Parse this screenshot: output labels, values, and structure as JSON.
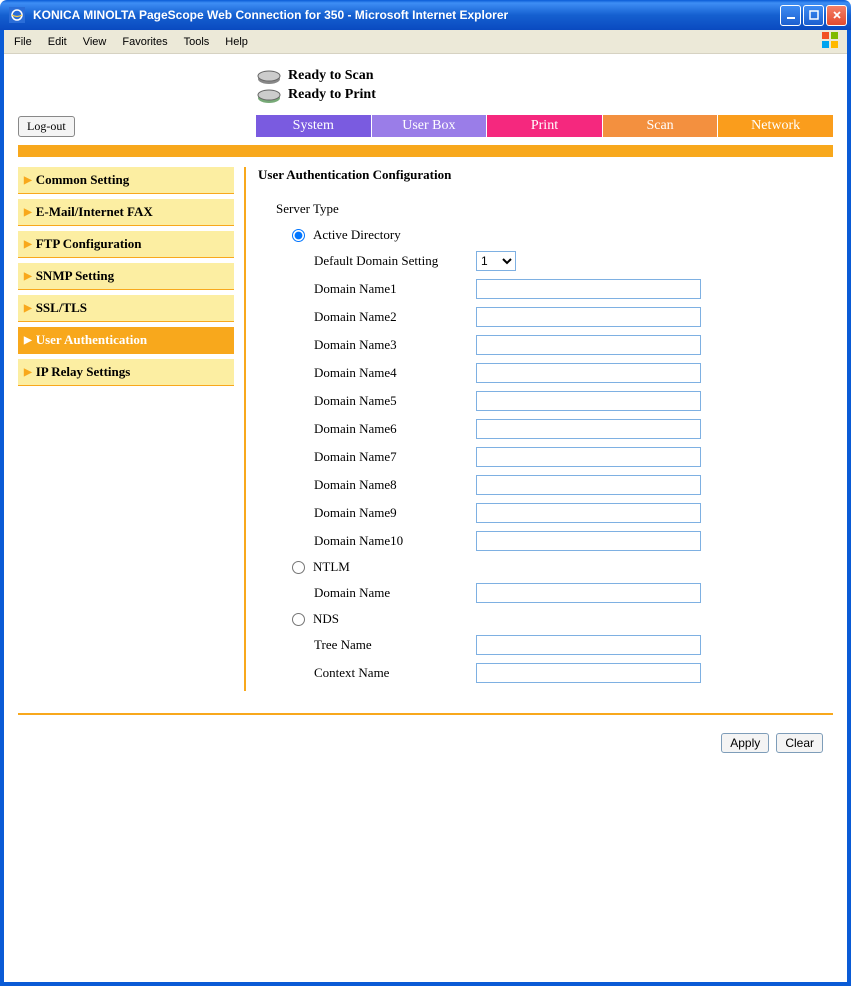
{
  "window": {
    "title": "KONICA MINOLTA PageScope Web Connection for 350 - Microsoft Internet Explorer"
  },
  "menubar": [
    "File",
    "Edit",
    "View",
    "Favorites",
    "Tools",
    "Help"
  ],
  "status": {
    "scan": "Ready to Scan",
    "print": "Ready to Print"
  },
  "logout": "Log-out",
  "tabs": {
    "system": "System",
    "userbox": "User Box",
    "print": "Print",
    "scan": "Scan",
    "network": "Network"
  },
  "sidebar": {
    "items": [
      {
        "label": "Common Setting"
      },
      {
        "label": "E-Mail/Internet FAX"
      },
      {
        "label": "FTP Configuration"
      },
      {
        "label": "SNMP Setting"
      },
      {
        "label": "SSL/TLS"
      },
      {
        "label": "User Authentication"
      },
      {
        "label": "IP Relay Settings"
      }
    ]
  },
  "content": {
    "title": "User Authentication Configuration",
    "server_type_label": "Server Type",
    "ad": {
      "label": "Active Directory",
      "default_domain_label": "Default Domain Setting",
      "default_domain_value": "1",
      "domain_labels": [
        "Domain Name1",
        "Domain Name2",
        "Domain Name3",
        "Domain Name4",
        "Domain Name5",
        "Domain Name6",
        "Domain Name7",
        "Domain Name8",
        "Domain Name9",
        "Domain Name10"
      ],
      "domain_values": [
        "",
        "",
        "",
        "",
        "",
        "",
        "",
        "",
        "",
        ""
      ]
    },
    "ntlm": {
      "label": "NTLM",
      "domain_label": "Domain Name",
      "domain_value": ""
    },
    "nds": {
      "label": "NDS",
      "tree_label": "Tree Name",
      "tree_value": "",
      "context_label": "Context Name",
      "context_value": ""
    }
  },
  "buttons": {
    "apply": "Apply",
    "clear": "Clear"
  }
}
